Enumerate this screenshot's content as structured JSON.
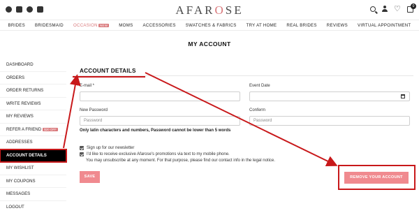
{
  "brand": {
    "logo_left": "AFAR",
    "logo_accent": "O",
    "logo_right": "SE"
  },
  "social_icons": [
    "facebook-icon",
    "instagram-icon",
    "pinterest-icon",
    "youtube-icon"
  ],
  "header_icons": {
    "search": "search-icon",
    "user": "user-icon",
    "wishlist": "heart-icon",
    "cart": "bag-icon",
    "cart_count": "0"
  },
  "nav": {
    "items": [
      {
        "label": "BRIDES"
      },
      {
        "label": "BRIDESMAID"
      },
      {
        "label": "OCCASION",
        "badge": "NEW"
      },
      {
        "label": "MOMS"
      },
      {
        "label": "ACCESSORIES"
      },
      {
        "label": "SWATCHES & FABRICS"
      },
      {
        "label": "TRY AT HOME"
      },
      {
        "label": "REAL BRIDES"
      },
      {
        "label": "REVIEWS"
      },
      {
        "label": "VIRTUAL APPOINTMENT"
      }
    ]
  },
  "page_title": "MY ACCOUNT",
  "sidebar": {
    "items": [
      {
        "label": "DASHBOARD"
      },
      {
        "label": "ORDERS"
      },
      {
        "label": "ORDER RETURNS"
      },
      {
        "label": "WRITE REVIEWS"
      },
      {
        "label": "MY REVIEWS"
      },
      {
        "label": "REFER A FRIEND",
        "badge": "$20 OFF"
      },
      {
        "label": "ADDRESSES"
      },
      {
        "label": "ACCOUNT DETAILS",
        "active": true
      },
      {
        "label": "MY WISHLIST"
      },
      {
        "label": "MY COUPONS"
      },
      {
        "label": "MESSAGES"
      },
      {
        "label": "LOGOUT"
      }
    ]
  },
  "form": {
    "section_title": "ACCOUNT DETAILS",
    "email_label": "E-mail *",
    "email_value": "",
    "event_date_label": "Event Date",
    "event_date_value": "",
    "new_password_label": "New Password",
    "new_password_placeholder": "Password",
    "confirm_label": "Conferm",
    "confirm_placeholder": "Password",
    "password_note": "Only latin characters and numbers, Password cannot be lower than 5 words",
    "newsletter_label": "Sign up for our newsletter",
    "sms_label": "I'd like to receive exclusive Afarose's promotions via text to my mobile phone.",
    "unsubscribe_note": "You may unsubscribe at any moment. For that purpose, please find our contact info in the legal notice.",
    "save_label": "SAVE",
    "remove_label": "REMOVE YOUR ACCOUNT"
  },
  "colors": {
    "accent": "#d9787b",
    "button": "#f08a8f",
    "annotation": "#c8181a"
  }
}
